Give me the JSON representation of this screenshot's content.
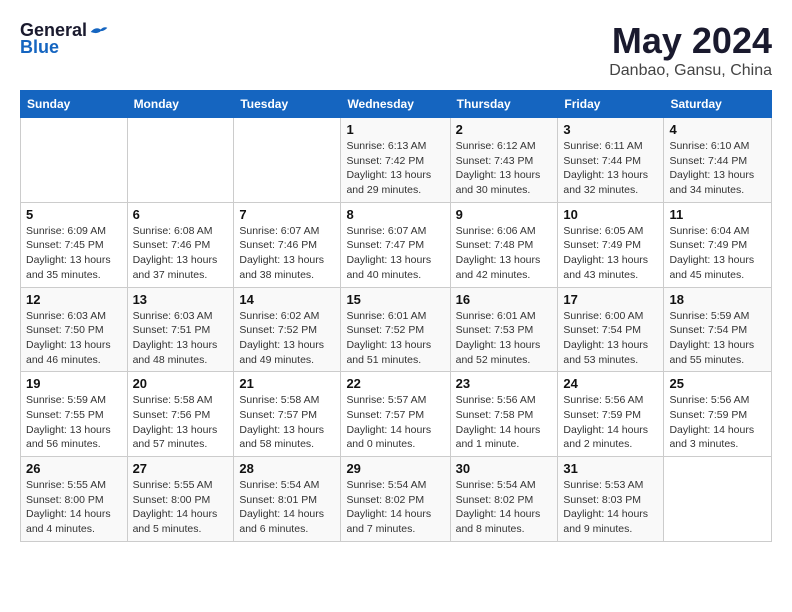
{
  "logo": {
    "general": "General",
    "blue": "Blue"
  },
  "title": "May 2024",
  "subtitle": "Danbao, Gansu, China",
  "weekdays": [
    "Sunday",
    "Monday",
    "Tuesday",
    "Wednesday",
    "Thursday",
    "Friday",
    "Saturday"
  ],
  "weeks": [
    [
      {
        "day": "",
        "info": ""
      },
      {
        "day": "",
        "info": ""
      },
      {
        "day": "",
        "info": ""
      },
      {
        "day": "1",
        "info": "Sunrise: 6:13 AM\nSunset: 7:42 PM\nDaylight: 13 hours\nand 29 minutes."
      },
      {
        "day": "2",
        "info": "Sunrise: 6:12 AM\nSunset: 7:43 PM\nDaylight: 13 hours\nand 30 minutes."
      },
      {
        "day": "3",
        "info": "Sunrise: 6:11 AM\nSunset: 7:44 PM\nDaylight: 13 hours\nand 32 minutes."
      },
      {
        "day": "4",
        "info": "Sunrise: 6:10 AM\nSunset: 7:44 PM\nDaylight: 13 hours\nand 34 minutes."
      }
    ],
    [
      {
        "day": "5",
        "info": "Sunrise: 6:09 AM\nSunset: 7:45 PM\nDaylight: 13 hours\nand 35 minutes."
      },
      {
        "day": "6",
        "info": "Sunrise: 6:08 AM\nSunset: 7:46 PM\nDaylight: 13 hours\nand 37 minutes."
      },
      {
        "day": "7",
        "info": "Sunrise: 6:07 AM\nSunset: 7:46 PM\nDaylight: 13 hours\nand 38 minutes."
      },
      {
        "day": "8",
        "info": "Sunrise: 6:07 AM\nSunset: 7:47 PM\nDaylight: 13 hours\nand 40 minutes."
      },
      {
        "day": "9",
        "info": "Sunrise: 6:06 AM\nSunset: 7:48 PM\nDaylight: 13 hours\nand 42 minutes."
      },
      {
        "day": "10",
        "info": "Sunrise: 6:05 AM\nSunset: 7:49 PM\nDaylight: 13 hours\nand 43 minutes."
      },
      {
        "day": "11",
        "info": "Sunrise: 6:04 AM\nSunset: 7:49 PM\nDaylight: 13 hours\nand 45 minutes."
      }
    ],
    [
      {
        "day": "12",
        "info": "Sunrise: 6:03 AM\nSunset: 7:50 PM\nDaylight: 13 hours\nand 46 minutes."
      },
      {
        "day": "13",
        "info": "Sunrise: 6:03 AM\nSunset: 7:51 PM\nDaylight: 13 hours\nand 48 minutes."
      },
      {
        "day": "14",
        "info": "Sunrise: 6:02 AM\nSunset: 7:52 PM\nDaylight: 13 hours\nand 49 minutes."
      },
      {
        "day": "15",
        "info": "Sunrise: 6:01 AM\nSunset: 7:52 PM\nDaylight: 13 hours\nand 51 minutes."
      },
      {
        "day": "16",
        "info": "Sunrise: 6:01 AM\nSunset: 7:53 PM\nDaylight: 13 hours\nand 52 minutes."
      },
      {
        "day": "17",
        "info": "Sunrise: 6:00 AM\nSunset: 7:54 PM\nDaylight: 13 hours\nand 53 minutes."
      },
      {
        "day": "18",
        "info": "Sunrise: 5:59 AM\nSunset: 7:54 PM\nDaylight: 13 hours\nand 55 minutes."
      }
    ],
    [
      {
        "day": "19",
        "info": "Sunrise: 5:59 AM\nSunset: 7:55 PM\nDaylight: 13 hours\nand 56 minutes."
      },
      {
        "day": "20",
        "info": "Sunrise: 5:58 AM\nSunset: 7:56 PM\nDaylight: 13 hours\nand 57 minutes."
      },
      {
        "day": "21",
        "info": "Sunrise: 5:58 AM\nSunset: 7:57 PM\nDaylight: 13 hours\nand 58 minutes."
      },
      {
        "day": "22",
        "info": "Sunrise: 5:57 AM\nSunset: 7:57 PM\nDaylight: 14 hours\nand 0 minutes."
      },
      {
        "day": "23",
        "info": "Sunrise: 5:56 AM\nSunset: 7:58 PM\nDaylight: 14 hours\nand 1 minute."
      },
      {
        "day": "24",
        "info": "Sunrise: 5:56 AM\nSunset: 7:59 PM\nDaylight: 14 hours\nand 2 minutes."
      },
      {
        "day": "25",
        "info": "Sunrise: 5:56 AM\nSunset: 7:59 PM\nDaylight: 14 hours\nand 3 minutes."
      }
    ],
    [
      {
        "day": "26",
        "info": "Sunrise: 5:55 AM\nSunset: 8:00 PM\nDaylight: 14 hours\nand 4 minutes."
      },
      {
        "day": "27",
        "info": "Sunrise: 5:55 AM\nSunset: 8:00 PM\nDaylight: 14 hours\nand 5 minutes."
      },
      {
        "day": "28",
        "info": "Sunrise: 5:54 AM\nSunset: 8:01 PM\nDaylight: 14 hours\nand 6 minutes."
      },
      {
        "day": "29",
        "info": "Sunrise: 5:54 AM\nSunset: 8:02 PM\nDaylight: 14 hours\nand 7 minutes."
      },
      {
        "day": "30",
        "info": "Sunrise: 5:54 AM\nSunset: 8:02 PM\nDaylight: 14 hours\nand 8 minutes."
      },
      {
        "day": "31",
        "info": "Sunrise: 5:53 AM\nSunset: 8:03 PM\nDaylight: 14 hours\nand 9 minutes."
      },
      {
        "day": "",
        "info": ""
      }
    ]
  ]
}
